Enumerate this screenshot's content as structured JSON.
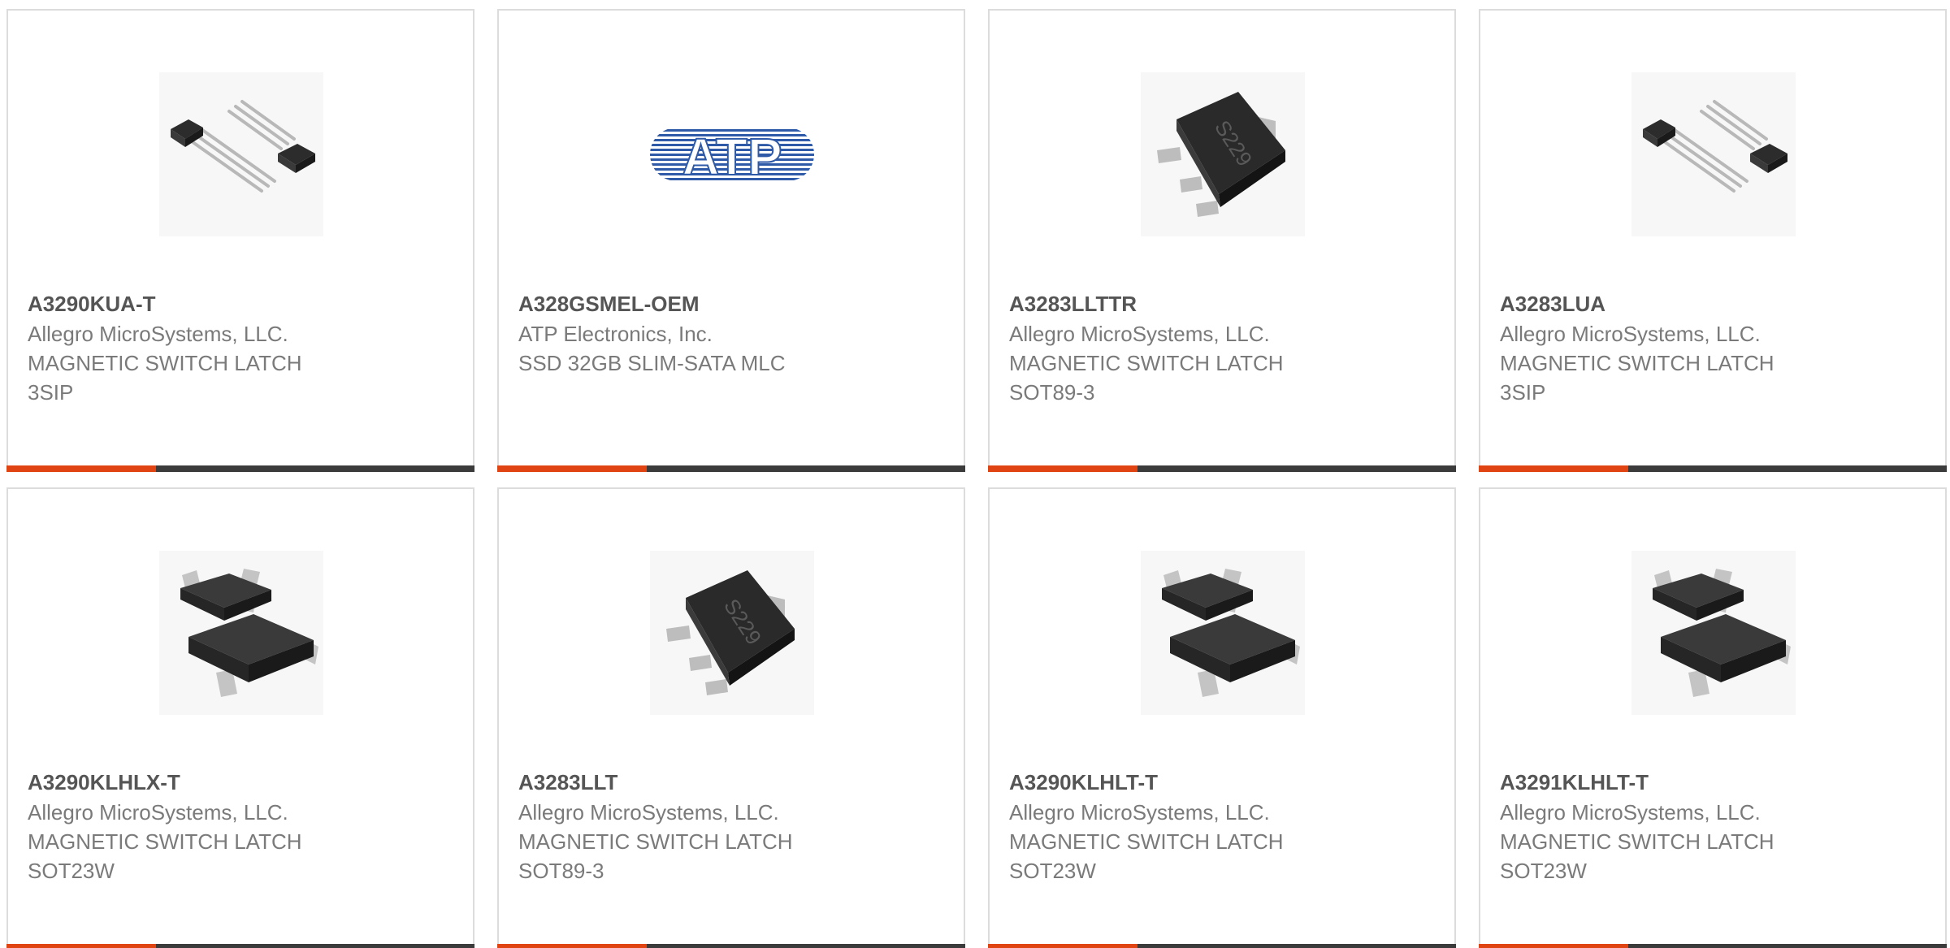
{
  "products": [
    {
      "part_number": "A3290KUA-T",
      "manufacturer": "Allegro MicroSystems, LLC.",
      "description": "MAGNETIC SWITCH LATCH",
      "package": "3SIP",
      "image": "sip3-icon"
    },
    {
      "part_number": "A328GSMEL-OEM",
      "manufacturer": "ATP Electronics, Inc.",
      "description": "SSD 32GB SLIM-SATA MLC",
      "package": "",
      "image": "atp-logo",
      "logo_text": "ATP"
    },
    {
      "part_number": "A3283LLTTR",
      "manufacturer": "Allegro MicroSystems, LLC.",
      "description": "MAGNETIC SWITCH LATCH",
      "package": "SOT89-3",
      "image": "sot89-icon",
      "chip_marking": "S229"
    },
    {
      "part_number": "A3283LUA",
      "manufacturer": "Allegro MicroSystems, LLC.",
      "description": "MAGNETIC SWITCH LATCH",
      "package": "3SIP",
      "image": "sip3-icon"
    },
    {
      "part_number": "A3290KLHLX-T",
      "manufacturer": "Allegro MicroSystems, LLC.",
      "description": "MAGNETIC SWITCH LATCH",
      "package": "SOT23W",
      "image": "sot23-icon"
    },
    {
      "part_number": "A3283LLT",
      "manufacturer": "Allegro MicroSystems, LLC.",
      "description": "MAGNETIC SWITCH LATCH",
      "package": "SOT89-3",
      "image": "sot89-icon",
      "chip_marking": "S229"
    },
    {
      "part_number": "A3290KLHLT-T",
      "manufacturer": "Allegro MicroSystems, LLC.",
      "description": "MAGNETIC SWITCH LATCH",
      "package": "SOT23W",
      "image": "sot23-icon"
    },
    {
      "part_number": "A3291KLHLT-T",
      "manufacturer": "Allegro MicroSystems, LLC.",
      "description": "MAGNETIC SWITCH LATCH",
      "package": "SOT23W",
      "image": "sot23-icon"
    }
  ],
  "colors": {
    "accent": "#e04412",
    "bar": "#3b3b3b",
    "border": "#dcdcdc",
    "part_number": "#555555",
    "text": "#7a7a7a",
    "atp_logo": "#2f5aa8"
  }
}
